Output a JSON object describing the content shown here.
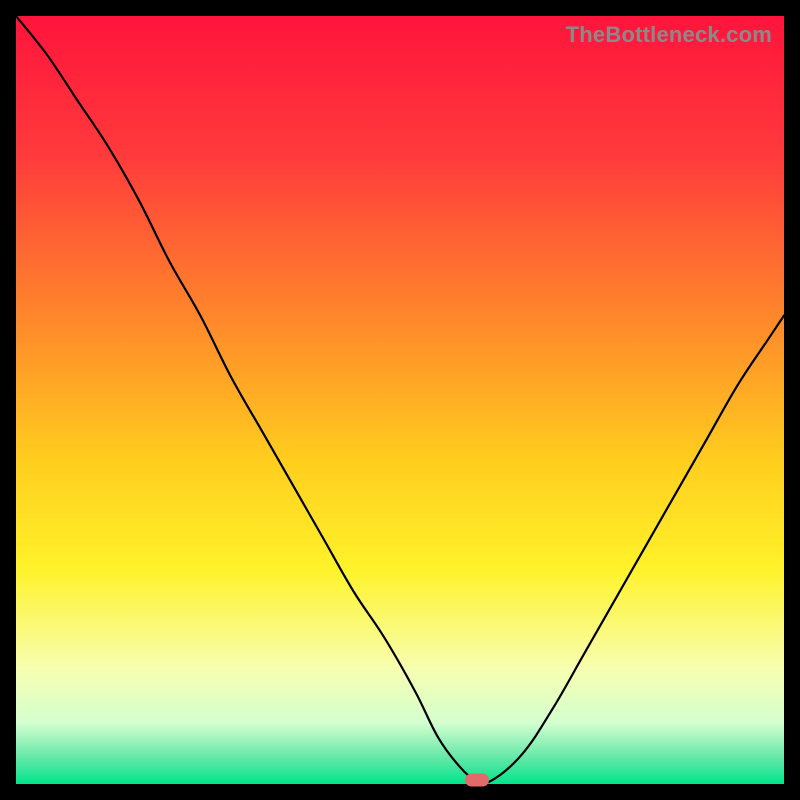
{
  "watermark": "TheBottleneck.com",
  "chart_data": {
    "type": "line",
    "title": "",
    "xlabel": "",
    "ylabel": "",
    "xlim": [
      0,
      100
    ],
    "ylim": [
      0,
      100
    ],
    "grid": false,
    "legend": false,
    "gradient_stops": [
      {
        "offset": 0.0,
        "color": "#ff143c"
      },
      {
        "offset": 0.18,
        "color": "#ff3a3c"
      },
      {
        "offset": 0.4,
        "color": "#ff8a2a"
      },
      {
        "offset": 0.58,
        "color": "#ffce1e"
      },
      {
        "offset": 0.72,
        "color": "#fff22a"
      },
      {
        "offset": 0.85,
        "color": "#f7ffb0"
      },
      {
        "offset": 0.92,
        "color": "#d4ffcf"
      },
      {
        "offset": 0.965,
        "color": "#66e8a8"
      },
      {
        "offset": 1.0,
        "color": "#00e58b"
      }
    ],
    "series": [
      {
        "name": "bottleneck-curve",
        "x": [
          0,
          4,
          8,
          12,
          16,
          20,
          24,
          28,
          32,
          36,
          40,
          44,
          48,
          52,
          55,
          58,
          60,
          62,
          66,
          70,
          74,
          78,
          82,
          86,
          90,
          94,
          98,
          100
        ],
        "y": [
          100,
          95,
          89,
          83,
          76,
          68,
          61,
          53,
          46,
          39,
          32,
          25,
          19,
          12,
          6,
          2,
          0.5,
          0.5,
          4,
          10,
          17,
          24,
          31,
          38,
          45,
          52,
          58,
          61
        ]
      }
    ],
    "marker": {
      "x": 60,
      "y": 0.5,
      "color": "#e26a6a"
    }
  }
}
